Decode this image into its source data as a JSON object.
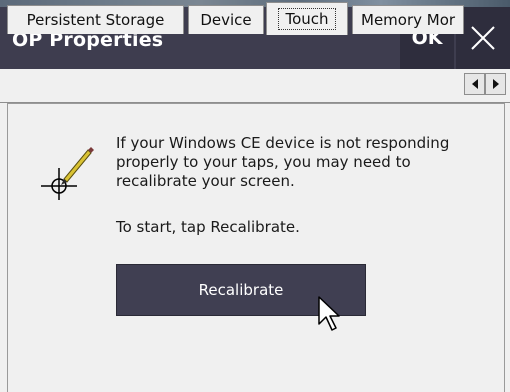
{
  "window": {
    "title": "OP Properties",
    "ok_label": "OK"
  },
  "tabs": [
    {
      "label": "Persistent Storage"
    },
    {
      "label": "Device"
    },
    {
      "label": "Touch"
    },
    {
      "label": "Memory Mor"
    }
  ],
  "touch": {
    "info": "If your Windows CE device is not responding properly to your taps, you may need to recalibrate your screen.",
    "instruction": "To start, tap Recalibrate.",
    "button_label": "Recalibrate"
  },
  "icons": [
    "crosshair-pen-icon",
    "close-icon",
    "chevron-left-icon",
    "chevron-right-icon",
    "mouse-cursor-icon"
  ]
}
